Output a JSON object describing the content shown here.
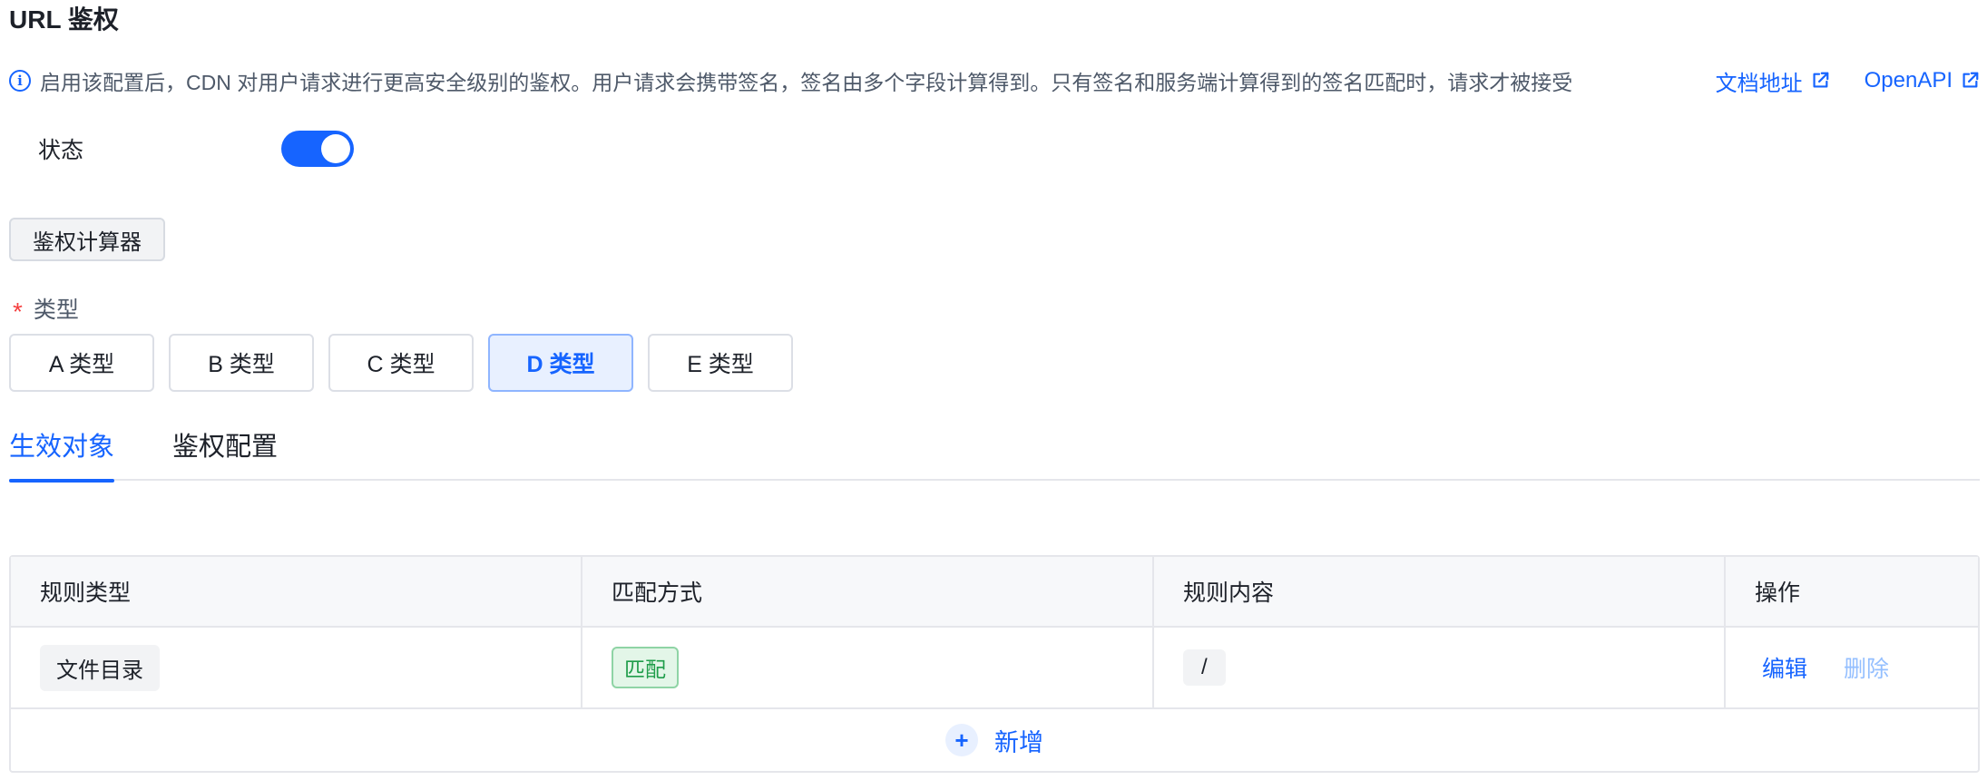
{
  "page": {
    "title": "URL 鉴权"
  },
  "info": {
    "icon": "info-icon",
    "text": "启用该配置后，CDN 对用户请求进行更高安全级别的鉴权。用户请求会携带签名，签名由多个字段计算得到。只有签名和服务端计算得到的签名匹配时，请求才被接受",
    "links": [
      {
        "label": "文档地址",
        "icon": "external-link-icon"
      },
      {
        "label": "OpenAPI",
        "icon": "external-link-icon"
      }
    ]
  },
  "status": {
    "label": "状态",
    "enabled": true
  },
  "calculator": {
    "label": "鉴权计算器"
  },
  "type_field": {
    "required_mark": "*",
    "label": "类型",
    "options": [
      "A 类型",
      "B 类型",
      "C 类型",
      "D 类型",
      "E 类型"
    ],
    "selected": "D 类型"
  },
  "tabs": [
    {
      "label": "生效对象",
      "active": true
    },
    {
      "label": "鉴权配置",
      "active": false
    }
  ],
  "table": {
    "columns": [
      "规则类型",
      "匹配方式",
      "规则内容",
      "操作"
    ],
    "rows": [
      {
        "rule_type": "文件目录",
        "match": "匹配",
        "content": "/",
        "actions": {
          "edit": "编辑",
          "delete": "删除"
        }
      }
    ],
    "add": {
      "icon": "+",
      "label": "新增"
    }
  },
  "colors": {
    "primary": "#1664ff",
    "success": "#1f9d4a",
    "required": "#f53f3f"
  }
}
